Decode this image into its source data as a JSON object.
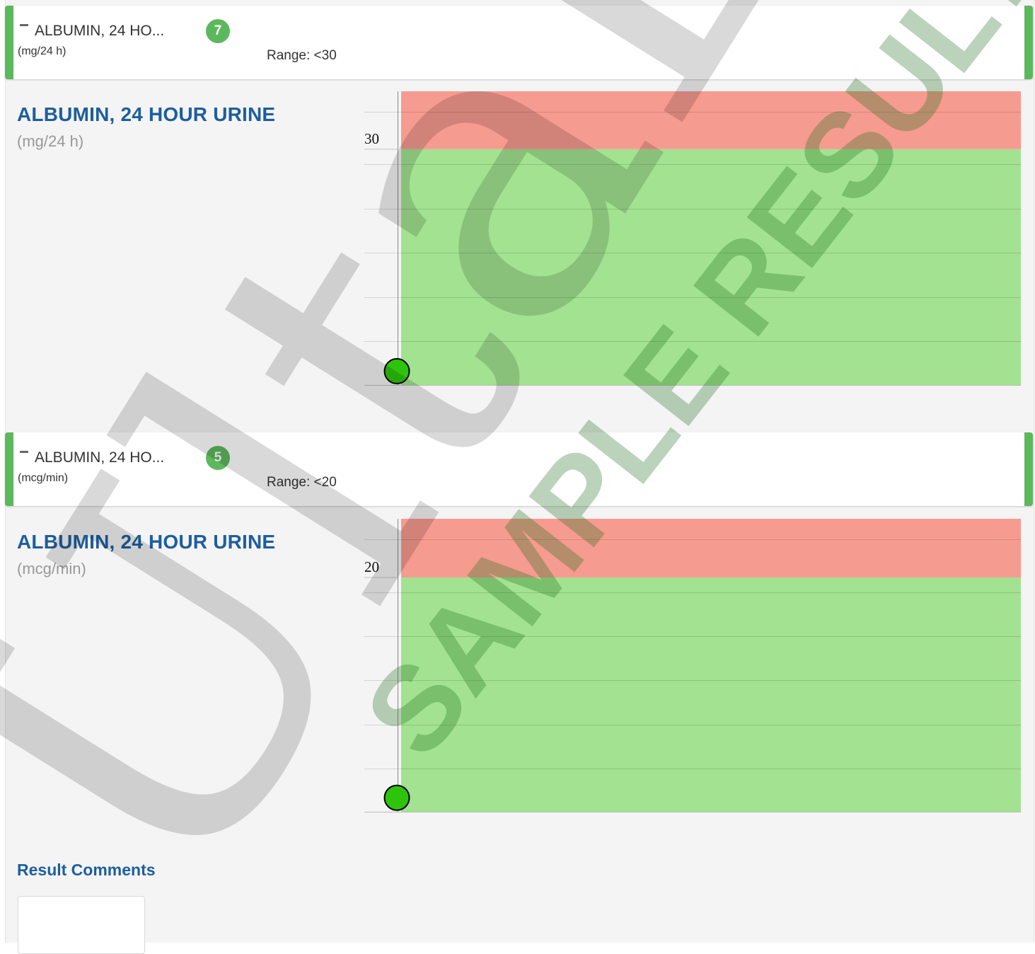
{
  "tests": [
    {
      "header_name": "ALBUMIN, 24 HO...",
      "header_unit": "(mg/24 h)",
      "result_count": "7",
      "range_text": "Range: <30",
      "detail_title": "ALBUMIN, 24 HOUR URINE",
      "detail_unit": "(mg/24 h)",
      "chart_data": {
        "type": "scatter",
        "reference_limit": 30,
        "reference_operator": "<",
        "y_ticks": [
          "30"
        ],
        "points": [
          {
            "y": 7
          }
        ],
        "ylim": [
          5.5,
          36
        ],
        "colors": {
          "abnormal_band": "#f69b90",
          "normal_band": "#a2e290",
          "point": "#2ec40c"
        }
      }
    },
    {
      "header_name": "ALBUMIN, 24 HO...",
      "header_unit": "(mcg/min)",
      "result_count": "5",
      "range_text": "Range: <20",
      "detail_title": "ALBUMIN, 24 HOUR URINE",
      "detail_unit": "(mcg/min)",
      "chart_data": {
        "type": "scatter",
        "reference_limit": 20,
        "reference_operator": "<",
        "y_ticks": [
          "20"
        ],
        "points": [
          {
            "y": 5
          }
        ],
        "ylim": [
          4,
          24
        ]
      }
    }
  ],
  "comments": {
    "title": "Result Comments",
    "text": ""
  },
  "watermark": {
    "logo_text": "UltaLab",
    "stamp_text": "SAMPLE RESULT"
  },
  "colors": {
    "accent_green": "#5cb85c",
    "title_blue": "#1d5e9e"
  }
}
